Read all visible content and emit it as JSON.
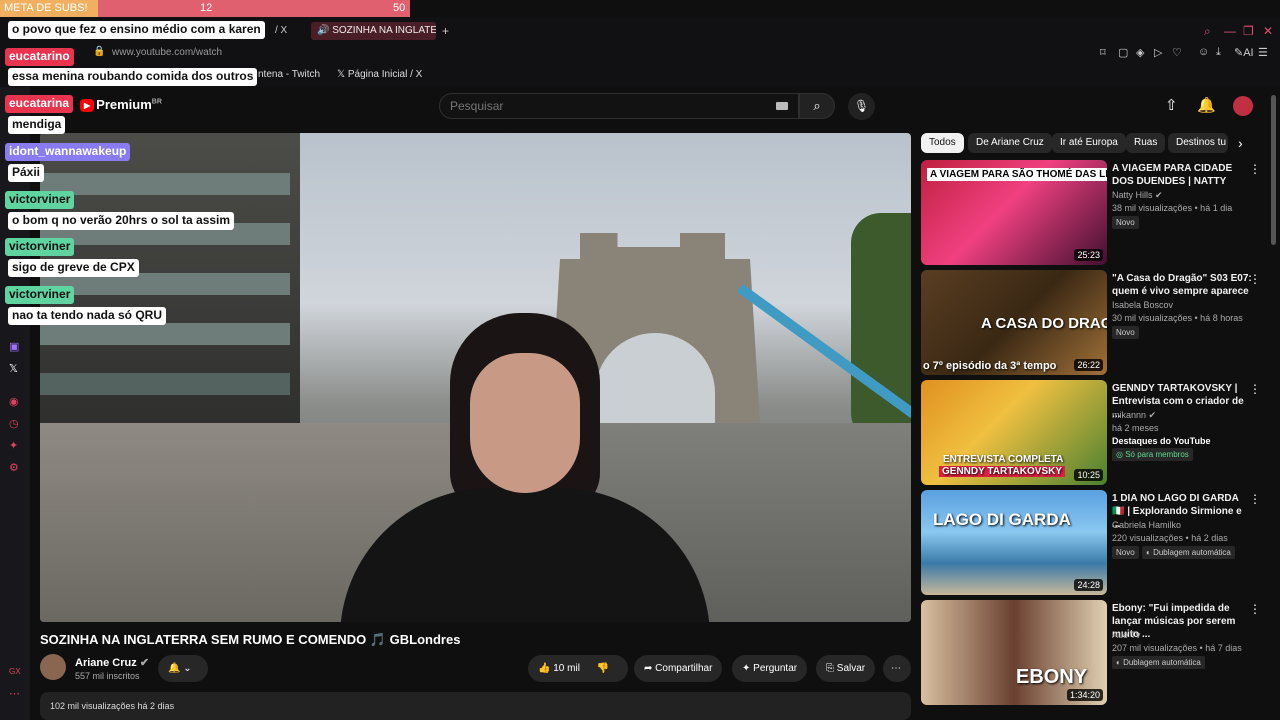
{
  "subs_meter": {
    "label": "META DE SUBS!",
    "current": "12",
    "goal": "50",
    "progress_fraction": 0.24
  },
  "browser": {
    "tab_title": "SOZINHA NA INGLATER",
    "tab_partial": "/ X",
    "url": "www.youtube.com/watch",
    "bookmarks": [
      "ntena - Twitch",
      "Página Inicial / X"
    ],
    "ai_label": "AI"
  },
  "left_rail": {
    "bottom_label": "GX"
  },
  "youtube": {
    "logo_text": "Premium",
    "logo_region": "BR",
    "search_placeholder": "Pesquisar"
  },
  "chat": [
    {
      "type": "msg",
      "text": "o povo que fez o ensino médio com a karen"
    },
    {
      "type": "user",
      "text": "eucatarino",
      "color": "#e8344f"
    },
    {
      "type": "msg",
      "text": "essa menina roubando comida dos outros"
    },
    {
      "type": "user",
      "text": "eucatarina",
      "color": "#e8344f"
    },
    {
      "type": "msg",
      "text": "mendiga"
    },
    {
      "type": "user",
      "text": "idont_wannawakeup",
      "color": "#8a7cf0"
    },
    {
      "type": "msg",
      "text": "Páxii"
    },
    {
      "type": "user",
      "text": "victorviner",
      "color": "#5fd4a0"
    },
    {
      "type": "msg",
      "text": "o bom q no verão 20hrs o sol ta assim"
    },
    {
      "type": "user",
      "text": "victorviner",
      "color": "#5fd4a0"
    },
    {
      "type": "msg",
      "text": "sigo de greve de CPX"
    },
    {
      "type": "user",
      "text": "victorviner",
      "color": "#5fd4a0"
    },
    {
      "type": "msg",
      "text": "nao ta tendo nada só QRU"
    }
  ],
  "video": {
    "title": "SOZINHA NA INGLATERRA SEM RUMO E COMENDO",
    "title_suffix": "GBLondres",
    "channel": "Ariane Cruz",
    "subscribers": "557 mil inscritos",
    "likes": "10 mil",
    "share_label": "Compartilhar",
    "ask_label": "Perguntar",
    "save_label": "Salvar",
    "views_line": "102 mil visualizações  há 2 dias"
  },
  "chips": [
    "Todos",
    "De Ariane Cruz",
    "Ir até Europa",
    "Ruas",
    "Destinos tu"
  ],
  "recommendations": [
    {
      "title": "A VIAGEM PARA CIDADE DOS DUENDES | NATTY",
      "channel": "Natty Hills",
      "meta": "38 mil visualizações • há 1 dia",
      "badge": "Novo",
      "duration": "25:23",
      "thumb_text": "A VIAGEM PARA SÃO THOMÉ DAS LETRAS"
    },
    {
      "title": "\"A Casa do Dragão\" S03 E07: quem é vivo sempre aparece",
      "channel": "Isabela Boscov",
      "meta": "30 mil visualizações • há 8 horas",
      "badge": "Novo",
      "duration": "26:22",
      "thumb_text": "A CASA DO DRAGÃO",
      "thumb_sub": "o 7º episódio da 3ª tempo"
    },
    {
      "title": "GENNDY TARTAKOVSKY | Entrevista com o criador de ...",
      "channel": "mikannn",
      "meta": "há 2 meses",
      "badge": "Destaques do YouTube",
      "badge2": "Só para membros",
      "duration": "10:25",
      "thumb_text": "ENTREVISTA COMPLETA",
      "thumb_sub": "GENNDY TARTAKOVSKY"
    },
    {
      "title": "1 DIA NO LAGO DI GARDA 🇮🇹 | Explorando Sirmione e ...",
      "channel": "Gabriela Hamilko",
      "meta": "220 visualizações • há 2 dias",
      "badge": "Novo",
      "badge2": "Dublagem automática",
      "duration": "24:28",
      "thumb_text": "LAGO DI GARDA"
    },
    {
      "title": "Ebony: \"Fui impedida de lançar músicas por serem muito ...",
      "channel": "Auê Tv",
      "meta": "207 mil visualizações • há 7 dias",
      "badge": "Dublagem automática",
      "duration": "1:34:20",
      "thumb_text": "EBONY"
    }
  ]
}
